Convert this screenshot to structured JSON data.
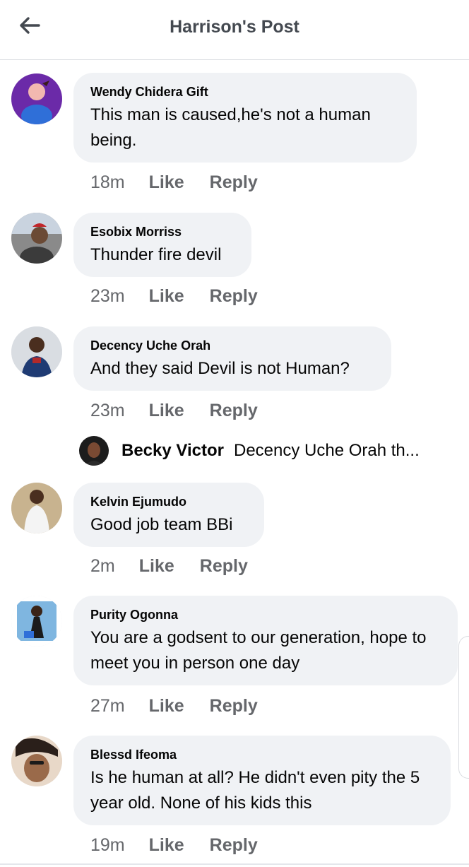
{
  "header": {
    "title": "Harrison's Post",
    "back_icon": "arrow-left-icon"
  },
  "comments": [
    {
      "author": "Wendy Chidera Gift",
      "text": "This man is caused,he's not a human being.",
      "time": "18m",
      "like": "Like",
      "reply": "Reply"
    },
    {
      "author": "Esobix Morriss",
      "text": "Thunder fire devil",
      "time": "23m",
      "like": "Like",
      "reply": "Reply"
    },
    {
      "author": "Decency Uche Orah",
      "text": "And they said Devil is not Human?",
      "time": "23m",
      "like": "Like",
      "reply": "Reply"
    },
    {
      "author": "Kelvin Ejumudo",
      "text": "Good job team BBi",
      "time": "2m",
      "like": "Like",
      "reply": "Reply"
    },
    {
      "author": "Purity Ogonna",
      "text": "You are a godsent to our generation, hope to meet you in person one day",
      "time": "27m",
      "like": "Like",
      "reply": "Reply"
    },
    {
      "author": "Blessd Ifeoma",
      "text": "Is he human at all? He didn't even pity the 5 year old. None of his kids this",
      "time": "19m",
      "like": "Like",
      "reply": "Reply"
    }
  ],
  "reply_preview": {
    "author": "Becky Victor",
    "text": "Decency Uche Orah th..."
  },
  "colors": {
    "bubble": "#f0f2f5",
    "meta": "#65676b",
    "title": "#444950"
  }
}
